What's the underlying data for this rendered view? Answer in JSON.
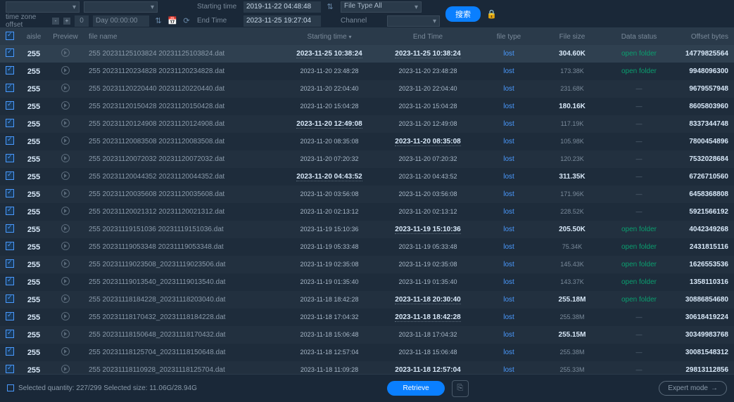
{
  "topbar": {
    "starting_time_label": "Starting time",
    "end_time_label": "End Time",
    "starting_time_value": "2019-11-22 04:48:48",
    "end_time_value": "2023-11-25 19:27:04",
    "file_type_label": "File Type All",
    "channel_label": "Channel",
    "day_label": "Day 00:00:00",
    "day_value": "0",
    "time_zone_label": "time zone offset",
    "search_btn": "搜索"
  },
  "headers": {
    "aisle": "aisle",
    "preview": "Preview",
    "file_name": "file name",
    "starting_time": "Starting time",
    "end_time": "End Time",
    "file_type": "file type",
    "file_size": "File size",
    "data_status": "Data status",
    "offset": "Offset bytes"
  },
  "rows": [
    {
      "aisle": "255",
      "file": "255 20231125103824 20231125103824.dat",
      "st": "2023-11-25 10:38:24",
      "st_b": true,
      "et": "2023-11-25 10:38:24",
      "et_b": true,
      "ft": "lost",
      "fs": "304.60K",
      "fs_b": true,
      "ds": "open folder",
      "off": "14779825564"
    },
    {
      "aisle": "255",
      "file": "255 20231120234828 20231120234828.dat",
      "st": "2023-11-20 23:48:28",
      "et": "2023-11-20 23:48:28",
      "ft": "lost",
      "fs": "173.38K",
      "ds": "open folder",
      "off": "9948096300"
    },
    {
      "aisle": "255",
      "file": "255 20231120220440 20231120220440.dat",
      "st": "2023-11-20 22:04:40",
      "et": "2023-11-20 22:04:40",
      "ft": "lost",
      "fs": "231.68K",
      "fs_dim": true,
      "ds": "",
      "off": "9679557948"
    },
    {
      "aisle": "255",
      "file": "255 20231120150428 20231120150428.dat",
      "st": "2023-11-20 15:04:28",
      "et": "2023-11-20 15:04:28",
      "ft": "lost",
      "fs": "180.16K",
      "fs_b": true,
      "ds": "",
      "off": "8605803960"
    },
    {
      "aisle": "255",
      "file": "255 20231120124908 20231120124908.dat",
      "st": "2023-11-20 12:49:08",
      "st_b": true,
      "et": "2023-11-20 12:49:08",
      "ft": "lost",
      "fs": "117.19K",
      "fs_dim": true,
      "ds": "",
      "off": "8337344748"
    },
    {
      "aisle": "255",
      "file": "255 20231120083508 20231120083508.dat",
      "st": "2023-11-20 08:35:08",
      "et": "2023-11-20 08:35:08",
      "et_b": true,
      "ft": "lost",
      "fs": "105.98K",
      "fs_dim": true,
      "ds": "",
      "off": "7800454896"
    },
    {
      "aisle": "255",
      "file": "255 20231120072032 20231120072032.dat",
      "st": "2023-11-20 07:20:32",
      "et": "2023-11-20 07:20:32",
      "ft": "lost",
      "fs": "120.23K",
      "fs_dim": true,
      "ds": "",
      "off": "7532028684"
    },
    {
      "aisle": "255",
      "file": "255 20231120044352 20231120044352.dat",
      "st": "2023-11-20 04:43:52",
      "st_b": true,
      "et": "2023-11-20 04:43:52",
      "ft": "lost",
      "fs": "311.35K",
      "fs_b": true,
      "ds": "",
      "off": "6726710560"
    },
    {
      "aisle": "255",
      "file": "255 20231120035608 20231120035608.dat",
      "st": "2023-11-20 03:56:08",
      "et": "2023-11-20 03:56:08",
      "ft": "lost",
      "fs": "171.96K",
      "fs_dim": true,
      "ds": "",
      "off": "6458368808"
    },
    {
      "aisle": "255",
      "file": "255 20231120021312 20231120021312.dat",
      "st": "2023-11-20 02:13:12",
      "et": "2023-11-20 02:13:12",
      "ft": "lost",
      "fs": "228.52K",
      "fs_dim": true,
      "ds": "",
      "off": "5921566192"
    },
    {
      "aisle": "255",
      "file": "255 20231119151036 20231119151036.dat",
      "st": "2023-11-19 15:10:36",
      "et": "2023-11-19 15:10:36",
      "et_b": true,
      "ft": "lost",
      "fs": "205.50K",
      "fs_b": true,
      "ds": "open folder",
      "off": "4042349268"
    },
    {
      "aisle": "255",
      "file": "255 20231119053348 20231119053348.dat",
      "st": "2023-11-19 05:33:48",
      "et": "2023-11-19 05:33:48",
      "ft": "lost",
      "fs": "75.34K",
      "fs_dim": true,
      "ds": "open folder",
      "off": "2431815116"
    },
    {
      "aisle": "255",
      "file": "255 20231119023508_20231119023506.dat",
      "st": "2023-11-19 02:35:08",
      "et": "2023-11-19 02:35:08",
      "ft": "lost",
      "fs": "145.43K",
      "fs_dim": true,
      "ds": "open folder",
      "off": "1626553536"
    },
    {
      "aisle": "255",
      "file": "255 20231119013540_20231119013540.dat",
      "st": "2023-11-19 01:35:40",
      "et": "2023-11-19 01:35:40",
      "ft": "lost",
      "fs": "143.37K",
      "fs_dim": true,
      "ds": "open folder",
      "off": "1358110316"
    },
    {
      "aisle": "255",
      "file": "255 20231118184228_20231118203040.dat",
      "st": "2023-11-18 18:42:28",
      "et": "2023-11-18 20:30:40",
      "et_b": true,
      "ft": "lost",
      "fs": "255.18M",
      "fs_b": true,
      "ds": "open folder",
      "off": "30886854680"
    },
    {
      "aisle": "255",
      "file": "255 20231118170432_20231118184228.dat",
      "st": "2023-11-18 17:04:32",
      "et": "2023-11-18 18:42:28",
      "et_b": true,
      "ft": "lost",
      "fs": "255.38M",
      "fs_dim": true,
      "ds": "",
      "off": "30618419224"
    },
    {
      "aisle": "255",
      "file": "255 20231118150648_20231118170432.dat",
      "st": "2023-11-18 15:06:48",
      "et": "2023-11-18 17:04:32",
      "ft": "lost",
      "fs": "255.15M",
      "fs_b": true,
      "ds": "",
      "off": "30349983768"
    },
    {
      "aisle": "255",
      "file": "255 20231118125704_20231118150648.dat",
      "st": "2023-11-18 12:57:04",
      "et": "2023-11-18 15:06:48",
      "ft": "lost",
      "fs": "255.38M",
      "fs_dim": true,
      "ds": "",
      "off": "30081548312"
    },
    {
      "aisle": "255",
      "file": "255 20231118110928_20231118125704.dat",
      "st": "2023-11-18 11:09:28",
      "et": "2023-11-18 12:57:04",
      "et_b": true,
      "ft": "lost",
      "fs": "255.33M",
      "fs_dim": true,
      "ds": "",
      "off": "29813112856"
    }
  ],
  "footer": {
    "selected": "Selected quantity: 227/299 Selected size: 11.06G/28.94G",
    "retrieve": "Retrieve",
    "expert": "Expert mode"
  }
}
